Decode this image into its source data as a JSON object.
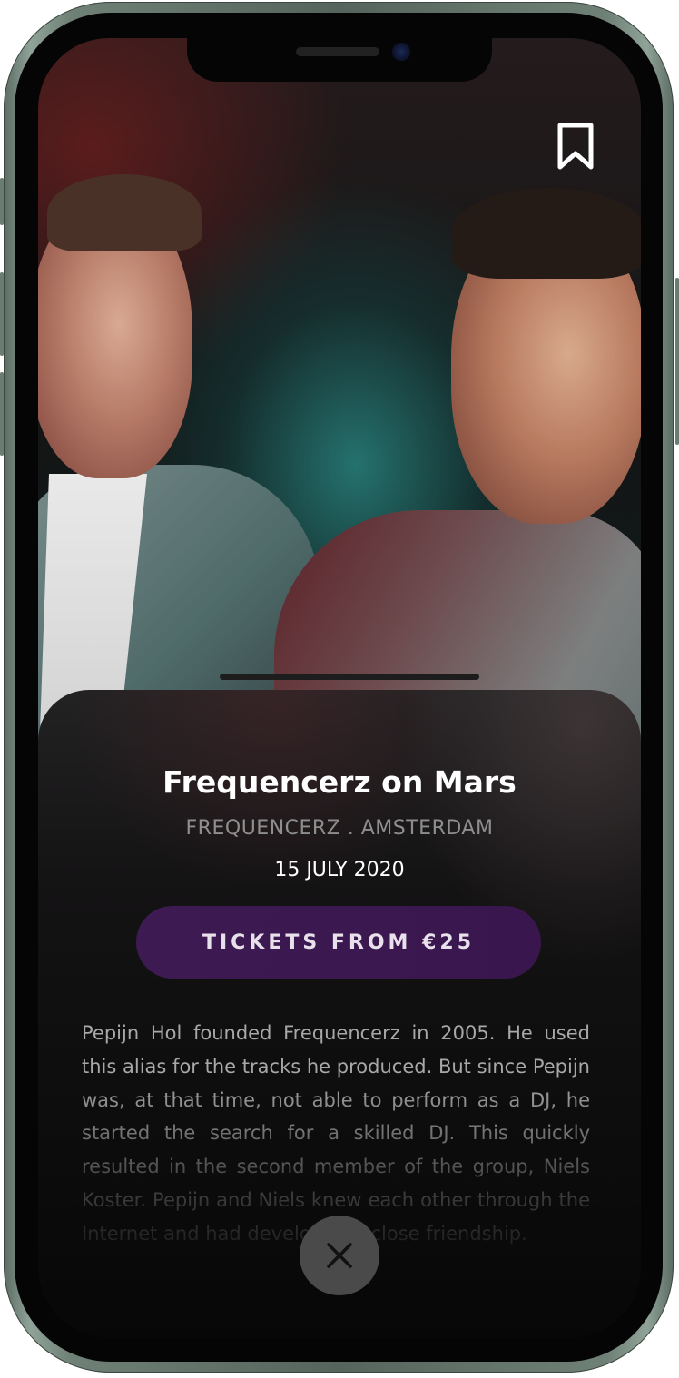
{
  "event": {
    "title": "Frequencerz on Mars",
    "subtitle": "FREQUENCERZ . AMSTERDAM",
    "date": "15 JULY 2020",
    "ticket_button_label": "TICKETS FROM €25",
    "description": "Pepijn Hol founded Frequencerz in 2005. He used this alias for the tracks he produced. But since Pepijn was, at that time, not able to perform as a DJ, he started the search for a skilled DJ. This quickly resulted in the second member of the group, Niels Koster. Pepijn and Niels knew each other through the Internet and had developed a close friendship."
  },
  "icons": {
    "bookmark": "bookmark-icon",
    "close": "close-icon"
  },
  "colors": {
    "ticket_button": "#3c1850",
    "title": "#ffffff",
    "subtitle": "#8e8e8e",
    "description": "#a8a8a8"
  }
}
